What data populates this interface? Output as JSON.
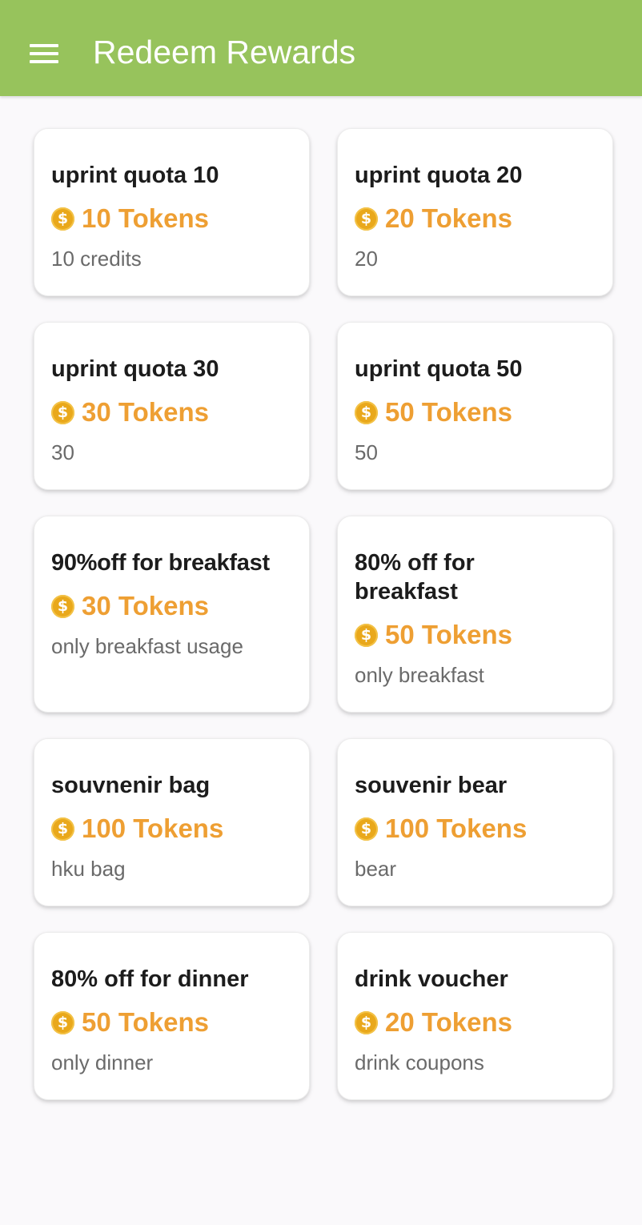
{
  "appbar": {
    "title": "Redeem Rewards",
    "menu_icon": "hamburger-menu-icon",
    "color": "#97c35c"
  },
  "accent": {
    "price_color": "#ee9f33",
    "coin_icon": "coin-icon"
  },
  "rewards": [
    {
      "title": "uprint quota 10",
      "price": "10 Tokens",
      "description": "10 credits"
    },
    {
      "title": "uprint quota 20",
      "price": "20 Tokens",
      "description": "20"
    },
    {
      "title": "uprint quota 30",
      "price": "30 Tokens",
      "description": "30"
    },
    {
      "title": "uprint quota 50",
      "price": "50 Tokens",
      "description": "50"
    },
    {
      "title": "90%off for breakfast",
      "price": "30 Tokens",
      "description": "only breakfast usage"
    },
    {
      "title": "80% off for breakfast",
      "price": "50 Tokens",
      "description": "only breakfast"
    },
    {
      "title": "souvnenir bag",
      "price": "100 Tokens",
      "description": "hku bag"
    },
    {
      "title": "souvenir bear",
      "price": "100 Tokens",
      "description": "bear"
    },
    {
      "title": "80% off for dinner",
      "price": "50 Tokens",
      "description": "only dinner"
    },
    {
      "title": "drink voucher",
      "price": "20 Tokens",
      "description": "drink coupons"
    }
  ]
}
